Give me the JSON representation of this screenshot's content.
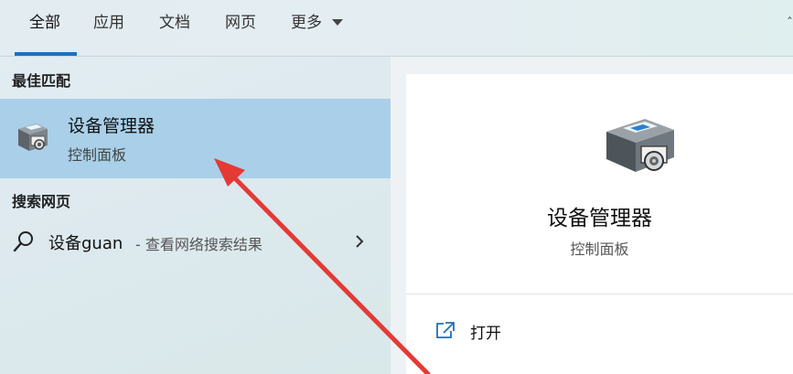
{
  "tabs": {
    "all": "全部",
    "apps": "应用",
    "documents": "文档",
    "web": "网页",
    "more": "更多"
  },
  "best_match": {
    "section_title": "最佳匹配",
    "title": "设备管理器",
    "subtitle": "控制面板",
    "icon": "device-manager-icon"
  },
  "web_search": {
    "section_title": "搜索网页",
    "query": "设备guan",
    "hint": "- 查看网络搜索结果",
    "icon": "search-icon"
  },
  "detail": {
    "title": "设备管理器",
    "subtitle": "控制面板",
    "actions": [
      {
        "label": "打开",
        "icon": "open-icon"
      }
    ]
  },
  "colors": {
    "accent": "#1f6fbf",
    "selected_row": "#a9d0e8",
    "annotation_arrow": "#e53935"
  }
}
